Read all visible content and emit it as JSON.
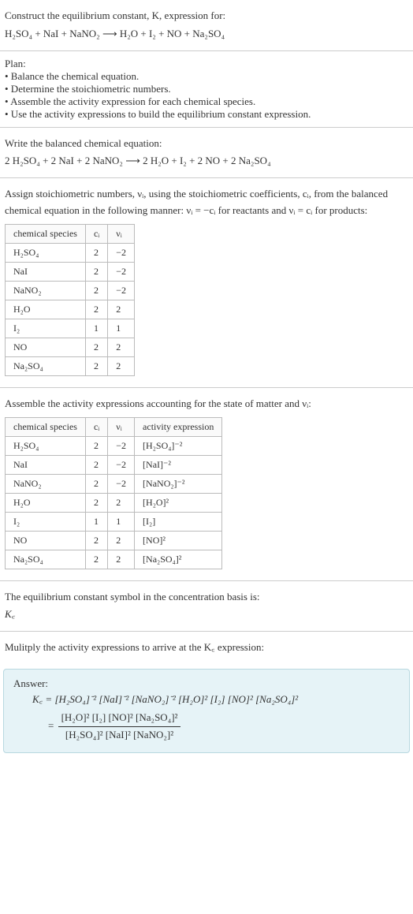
{
  "s1": {
    "l1": "Construct the equilibrium constant, K, expression for:",
    "l2": "H₂SO₄ + NaI + NaNO₂  ⟶  H₂O + I₂ + NO + Na₂SO₄"
  },
  "s2": {
    "h": "Plan:",
    "b1": "• Balance the chemical equation.",
    "b2": "• Determine the stoichiometric numbers.",
    "b3": "• Assemble the activity expression for each chemical species.",
    "b4": "• Use the activity expressions to build the equilibrium constant expression."
  },
  "s3": {
    "l1": "Write the balanced chemical equation:",
    "l2": "2 H₂SO₄ + 2 NaI + 2 NaNO₂  ⟶  2 H₂O + I₂ + 2 NO + 2 Na₂SO₄"
  },
  "s4": {
    "l1": "Assign stoichiometric numbers, νᵢ, using the stoichiometric coefficients, cᵢ, from the balanced chemical equation in the following manner: νᵢ = −cᵢ for reactants and νᵢ = cᵢ for products:",
    "h1": "chemical species",
    "h2": "cᵢ",
    "h3": "νᵢ",
    "r": [
      {
        "a": "H₂SO₄",
        "b": "2",
        "c": "−2"
      },
      {
        "a": "NaI",
        "b": "2",
        "c": "−2"
      },
      {
        "a": "NaNO₂",
        "b": "2",
        "c": "−2"
      },
      {
        "a": "H₂O",
        "b": "2",
        "c": "2"
      },
      {
        "a": "I₂",
        "b": "1",
        "c": "1"
      },
      {
        "a": "NO",
        "b": "2",
        "c": "2"
      },
      {
        "a": "Na₂SO₄",
        "b": "2",
        "c": "2"
      }
    ]
  },
  "s5": {
    "l1": "Assemble the activity expressions accounting for the state of matter and νᵢ:",
    "h1": "chemical species",
    "h2": "cᵢ",
    "h3": "νᵢ",
    "h4": "activity expression",
    "r": [
      {
        "a": "H₂SO₄",
        "b": "2",
        "c": "−2",
        "d": "[H₂SO₄]⁻²"
      },
      {
        "a": "NaI",
        "b": "2",
        "c": "−2",
        "d": "[NaI]⁻²"
      },
      {
        "a": "NaNO₂",
        "b": "2",
        "c": "−2",
        "d": "[NaNO₂]⁻²"
      },
      {
        "a": "H₂O",
        "b": "2",
        "c": "2",
        "d": "[H₂O]²"
      },
      {
        "a": "I₂",
        "b": "1",
        "c": "1",
        "d": "[I₂]"
      },
      {
        "a": "NO",
        "b": "2",
        "c": "2",
        "d": "[NO]²"
      },
      {
        "a": "Na₂SO₄",
        "b": "2",
        "c": "2",
        "d": "[Na₂SO₄]²"
      }
    ]
  },
  "s6": {
    "l1": "The equilibrium constant symbol in the concentration basis is:",
    "l2": "K꜀"
  },
  "s7": {
    "l1": "Mulitply the activity expressions to arrive at the K꜀ expression:"
  },
  "ans": {
    "h": "Answer:",
    "line1": "K꜀ = [H₂SO₄]⁻² [NaI]⁻² [NaNO₂]⁻² [H₂O]² [I₂] [NO]² [Na₂SO₄]²",
    "eq": "=",
    "num": "[H₂O]² [I₂] [NO]² [Na₂SO₄]²",
    "den": "[H₂SO₄]² [NaI]² [NaNO₂]²"
  }
}
